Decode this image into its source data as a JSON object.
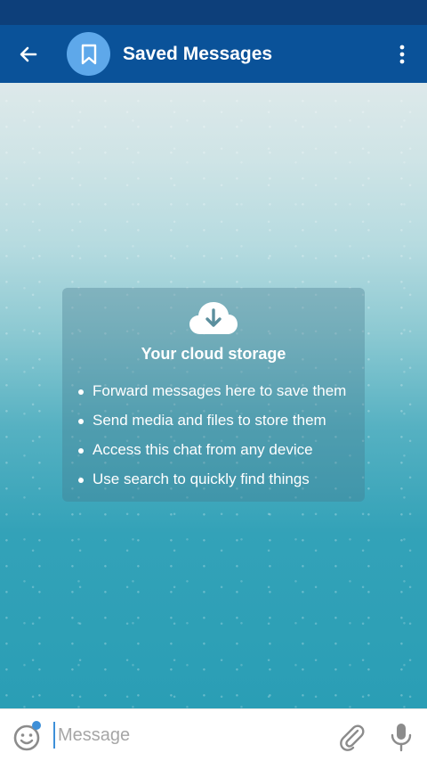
{
  "colors": {
    "status_bar": "#0d3f7a",
    "app_bar": "#0a5299",
    "avatar": "#5ea8ea",
    "accent": "#3d8fd8"
  },
  "header": {
    "back_icon": "arrow-left-icon",
    "avatar_icon": "bookmark-icon",
    "title": "Saved Messages",
    "menu_icon": "more-vertical-icon"
  },
  "cloud_card": {
    "icon": "cloud-download-icon",
    "title": "Your cloud storage",
    "items": [
      "Forward messages here to save them",
      "Send media and files to store them",
      "Access this chat from any device",
      "Use search to quickly find things"
    ]
  },
  "composer": {
    "emoji_icon": "smiley-icon",
    "placeholder": "Message",
    "attach_icon": "paperclip-icon",
    "mic_icon": "microphone-icon"
  }
}
